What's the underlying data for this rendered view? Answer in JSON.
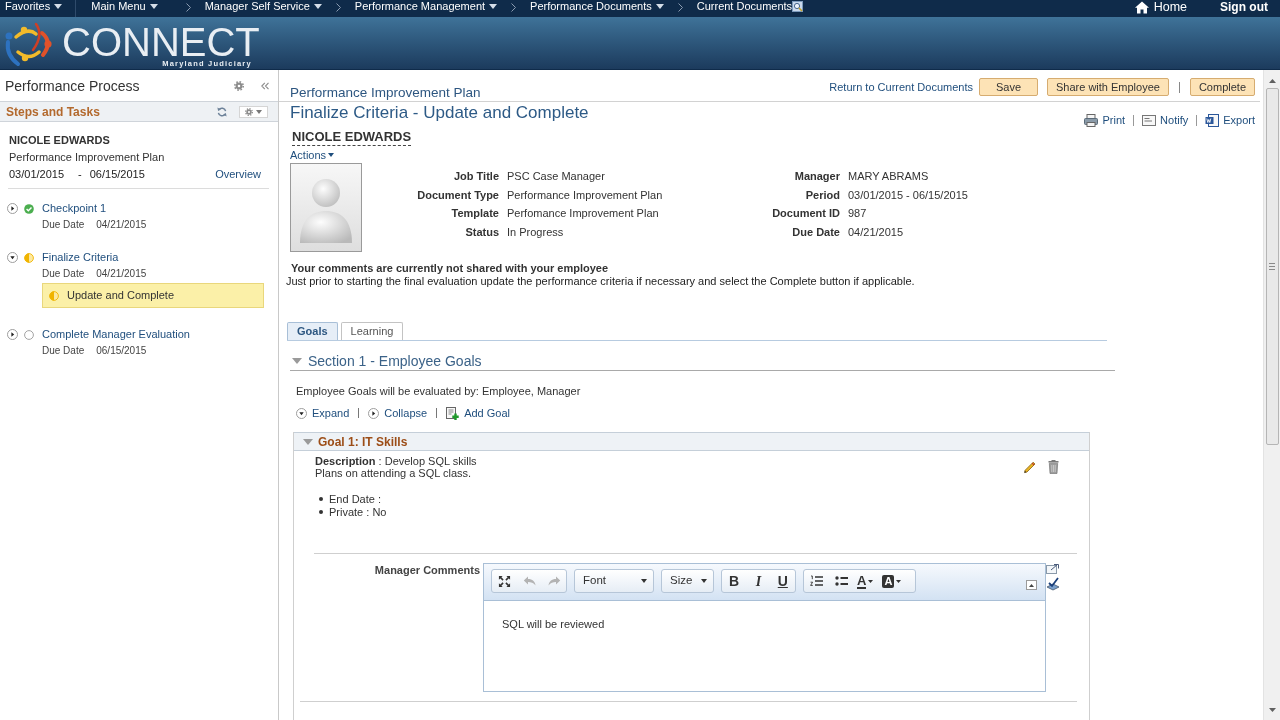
{
  "nav": {
    "items": [
      {
        "label": "Favorites",
        "kind": "menu"
      },
      {
        "label": "Main Menu",
        "kind": "menu"
      },
      {
        "label": "Manager Self Service",
        "kind": "menu"
      },
      {
        "label": "Performance Management",
        "kind": "menu"
      },
      {
        "label": "Performance Documents",
        "kind": "menu"
      },
      {
        "label": "Current Documents",
        "kind": "page"
      }
    ],
    "home": "Home",
    "sign_out": "Sign out"
  },
  "banner": {
    "logo": "CONNECT",
    "subtitle": "Maryland Judiciary"
  },
  "sidebar": {
    "title": "Performance Process",
    "panel_title": "Steps and Tasks",
    "employee": "NICOLE EDWARDS",
    "document_type": "Performance Improvement Plan",
    "period_start": "03/01/2015",
    "period_separator": "-",
    "period_end": "06/15/2015",
    "overview": "Overview",
    "steps": [
      {
        "title": "Checkpoint 1",
        "kind": "complete",
        "expanded": false,
        "due_label": "Due Date",
        "due_date": "04/21/2015"
      },
      {
        "title": "Finalize Criteria",
        "kind": "started",
        "expanded": true,
        "due_label": "Due Date",
        "due_date": "04/21/2015",
        "tasks": [
          {
            "label": "Update and Complete",
            "kind": "started",
            "selected": true
          }
        ]
      },
      {
        "title": "Complete Manager Evaluation",
        "kind": "pending",
        "expanded": false,
        "due_label": "Due Date",
        "due_date": "06/15/2015"
      }
    ]
  },
  "document": {
    "heading": "Performance Improvement Plan",
    "return_link": "Return to Current Documents",
    "buttons": [
      "Save",
      "Share with Employee",
      "Complete"
    ],
    "title": "Finalize Criteria - Update and Complete",
    "tools": [
      {
        "label": "Print",
        "kind": "print"
      },
      {
        "label": "Notify",
        "kind": "notify"
      },
      {
        "label": "Export",
        "kind": "export"
      }
    ]
  },
  "employee": {
    "name": "NICOLE EDWARDS",
    "actions": "Actions",
    "details_left": [
      {
        "label": "Job Title",
        "value": "PSC Case Manager"
      },
      {
        "label": "Document Type",
        "value": "Performance Improvement Plan"
      },
      {
        "label": "Template",
        "value": "Perfomance Improvement Plan"
      },
      {
        "label": "Status",
        "value": "In Progress"
      }
    ],
    "details_right": [
      {
        "label": "Manager",
        "value": "MARY ABRAMS"
      },
      {
        "label": "Period",
        "value": "03/01/2015 - 06/15/2015"
      },
      {
        "label": "Document ID",
        "value": "987"
      },
      {
        "label": "Due Date",
        "value": "04/21/2015"
      }
    ]
  },
  "notice": {
    "title": "Your comments are currently not shared with your employee",
    "text": "Just prior to starting the final evaluation update the performance criteria if necessary and select the Complete button if applicable."
  },
  "tabs": [
    {
      "label": "Goals",
      "selected": true
    },
    {
      "label": "Learning",
      "selected": false
    }
  ],
  "section": {
    "title": "Section 1 - Employee Goals",
    "expanded": true,
    "evaluated_by": "Employee Goals will be evaluated by: Employee, Manager",
    "actions": [
      {
        "label": "Expand",
        "kind": "expand"
      },
      {
        "label": "Collapse",
        "kind": "collapse"
      },
      {
        "label": "Add Goal",
        "kind": "add"
      }
    ],
    "goals": [
      {
        "title": "Goal 1: IT Skills",
        "expanded": true,
        "description": "**Description** : Develop SQL skills",
        "details": "Plans on attending a SQL class.",
        "attributes": [
          "End Date :",
          "Private : No"
        ],
        "comments_label": "Manager Comments",
        "editor": {
          "history_buttons": [
            {
              "kind": "undo",
              "disabled": true
            },
            {
              "kind": "redo",
              "disabled": true
            }
          ],
          "font": "Font",
          "size": "Size",
          "format_buttons": [
            {
              "label": "B",
              "kind": "bold"
            },
            {
              "label": "I",
              "kind": "italic"
            },
            {
              "label": "U",
              "kind": "underline"
            }
          ],
          "color_buttons": [
            {
              "label": "A",
              "kind": "text_color"
            },
            {
              "label": "A",
              "kind": "background_color"
            }
          ],
          "content": "SQL will be reviewed"
        }
      }
    ]
  }
}
